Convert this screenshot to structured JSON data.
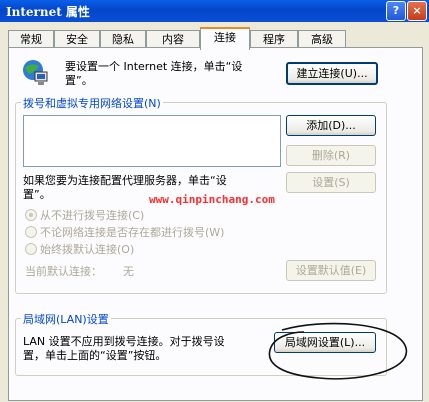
{
  "window": {
    "title": "Internet 属性",
    "help_button": "?",
    "close_button": "×"
  },
  "tabs": [
    {
      "label": "常规"
    },
    {
      "label": "安全"
    },
    {
      "label": "隐私"
    },
    {
      "label": "内容"
    },
    {
      "label": "连接"
    },
    {
      "label": "程序"
    },
    {
      "label": "高级"
    }
  ],
  "active_tab": "连接",
  "setup": {
    "line1": "要设置一个 Internet 连接，单击“设",
    "line2": "置”。",
    "button": "建立连接(U)..."
  },
  "dialup": {
    "group_title": "拨号和虚拟专用网络设置(N)",
    "add_button": "添加(D)...",
    "remove_button": "删除(R)",
    "settings_button": "设置(S)",
    "proxy_line1": "如果您要为连接配置代理服务器，单击“设",
    "proxy_line2": "置”。",
    "radio_never": "从不进行拨号连接(C)",
    "radio_when_none": "不论网络连接是否存在都进行拨号(W)",
    "radio_always": "始终拨默认连接(O)",
    "default_label": "当前默认连接：",
    "default_value": "无",
    "set_default_button": "设置默认值(E)"
  },
  "lan": {
    "group_title": "局域网(LAN)设置",
    "line1": "LAN 设置不应用到拨号连接。对于拨号设",
    "line2": "置，单击上面的“设置”按钮。",
    "button": "局域网设置(L)..."
  },
  "watermark": "www.qinpinchang.com",
  "colors": {
    "titlebar": "#0a5ee8",
    "accent_tab": "#e68b2c",
    "group_title": "#0046d5",
    "watermark": "#ff2d2d"
  }
}
